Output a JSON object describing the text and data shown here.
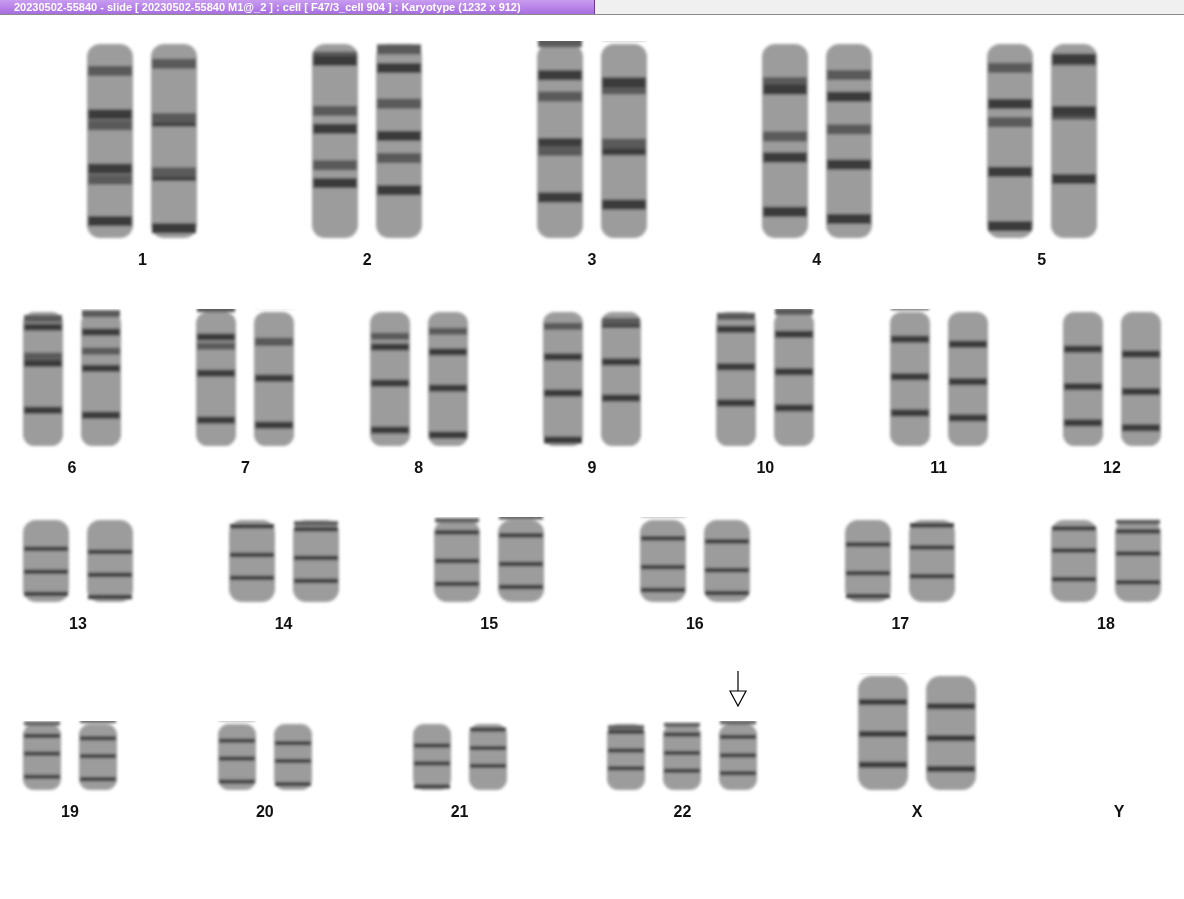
{
  "title_tab": "20230502-55840 - slide [ 20230502-55840 M1@_2 ] : cell [ F47/3_cell 904 ] : Karyotype  (1232 x 912)",
  "rows": [
    {
      "groups": [
        {
          "label": "1",
          "chromosomes": [
            {
              "marked": false
            },
            {
              "marked": false
            }
          ]
        },
        {
          "label": "2",
          "chromosomes": [
            {
              "marked": false
            },
            {
              "marked": false
            }
          ]
        },
        {
          "label": "3",
          "chromosomes": [
            {
              "marked": false
            },
            {
              "marked": false
            }
          ]
        },
        {
          "label": "4",
          "chromosomes": [
            {
              "marked": false
            },
            {
              "marked": false
            }
          ]
        },
        {
          "label": "5",
          "chromosomes": [
            {
              "marked": false
            },
            {
              "marked": false
            }
          ]
        }
      ]
    },
    {
      "groups": [
        {
          "label": "6",
          "chromosomes": [
            {
              "marked": false
            },
            {
              "marked": false
            }
          ]
        },
        {
          "label": "7",
          "chromosomes": [
            {
              "marked": false
            },
            {
              "marked": false
            }
          ]
        },
        {
          "label": "8",
          "chromosomes": [
            {
              "marked": false
            },
            {
              "marked": false
            }
          ]
        },
        {
          "label": "9",
          "chromosomes": [
            {
              "marked": false
            },
            {
              "marked": false
            }
          ]
        },
        {
          "label": "10",
          "chromosomes": [
            {
              "marked": false
            },
            {
              "marked": false
            }
          ]
        },
        {
          "label": "11",
          "chromosomes": [
            {
              "marked": false
            },
            {
              "marked": false
            }
          ]
        },
        {
          "label": "12",
          "chromosomes": [
            {
              "marked": false
            },
            {
              "marked": false
            }
          ]
        }
      ]
    },
    {
      "groups": [
        {
          "label": "13",
          "chromosomes": [
            {
              "marked": false
            },
            {
              "marked": false
            }
          ]
        },
        {
          "label": "14",
          "chromosomes": [
            {
              "marked": false
            },
            {
              "marked": false
            }
          ]
        },
        {
          "label": "15",
          "chromosomes": [
            {
              "marked": false
            },
            {
              "marked": false
            }
          ]
        },
        {
          "label": "16",
          "chromosomes": [
            {
              "marked": false
            },
            {
              "marked": false
            }
          ]
        },
        {
          "label": "17",
          "chromosomes": [
            {
              "marked": false
            },
            {
              "marked": false
            }
          ]
        },
        {
          "label": "18",
          "chromosomes": [
            {
              "marked": false
            },
            {
              "marked": false
            }
          ]
        }
      ]
    },
    {
      "groups": [
        {
          "label": "19",
          "chromosomes": [
            {
              "marked": false
            },
            {
              "marked": false
            }
          ]
        },
        {
          "label": "20",
          "chromosomes": [
            {
              "marked": false
            },
            {
              "marked": false
            }
          ]
        },
        {
          "label": "21",
          "chromosomes": [
            {
              "marked": false
            },
            {
              "marked": false
            }
          ]
        },
        {
          "label": "22",
          "chromosomes": [
            {
              "marked": false
            },
            {
              "marked": false
            },
            {
              "marked": true
            }
          ]
        },
        {
          "label": "X",
          "chromosomes": [
            {
              "marked": false
            },
            {
              "marked": false
            }
          ]
        },
        {
          "label": "Y"
        }
      ]
    }
  ]
}
